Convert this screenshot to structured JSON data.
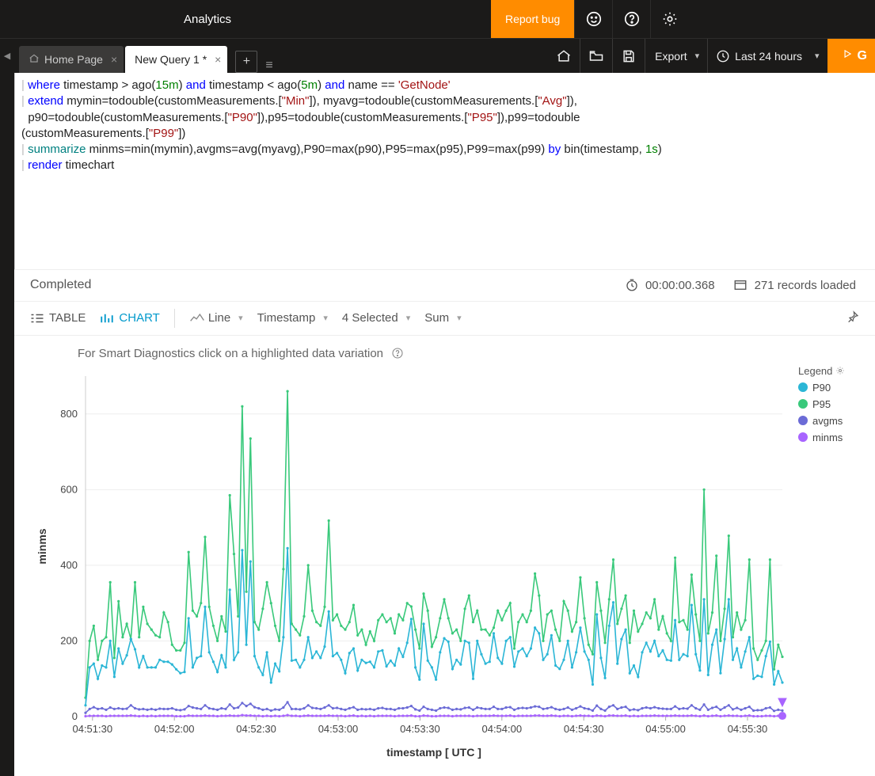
{
  "header": {
    "brand": "Analytics",
    "report_bug": "Report bug"
  },
  "tabs": {
    "home": "Home Page",
    "active": "New Query 1 *"
  },
  "toolbar": {
    "export": "Export",
    "time_range": "Last 24 hours",
    "go": "G"
  },
  "editor": {
    "l1a": "| ",
    "l1_where": "where",
    "l1b": " timestamp > ago(",
    "l1_15m": "15m",
    "l1c": ") ",
    "l1_and1": "and",
    "l1d": " timestamp < ago(",
    "l1_5m": "5m",
    "l1e": ") ",
    "l1_and2": "and",
    "l1f": " name == ",
    "l1_str": "'GetNode'",
    "l2a": "| ",
    "l2_extend": "extend",
    "l2b": " mymin=todouble(customMeasurements.[",
    "l2_min": "\"Min\"",
    "l2c": "]), myavg=todouble(customMeasurements.[",
    "l2_avg": "\"Avg\"",
    "l2d": "]),",
    "l3a": "  p90=todouble(customMeasurements.[",
    "l3_p90": "\"P90\"",
    "l3b": "]),p95=todouble(customMeasurements.[",
    "l3_p95": "\"P95\"",
    "l3c": "]),p99=todouble",
    "l4a": "(customMeasurements.[",
    "l4_p99": "\"P99\"",
    "l4b": "])",
    "l5a": "| ",
    "l5_sum": "summarize",
    "l5b": " minms=min(mymin),avgms=avg(myavg),P90=max(p90),P95=max(p95),P99=max(p99) ",
    "l5_by": "by",
    "l5c": " bin(timestamp, ",
    "l5_1s": "1s",
    "l5d": ")",
    "l6a": "| ",
    "l6_render": "render",
    "l6b": " timechart"
  },
  "status": {
    "completed": "Completed",
    "duration": "00:00:00.368",
    "records": "271 records loaded"
  },
  "chart_toolbar": {
    "table": "TABLE",
    "chart": "CHART",
    "chart_type": "Line",
    "x_axis": "Timestamp",
    "selected": "4 Selected",
    "agg": "Sum"
  },
  "smart_diag": "For Smart Diagnostics click on a highlighted data variation",
  "legend": {
    "title": "Legend",
    "items": [
      {
        "name": "P90",
        "color": "#2bb6d6"
      },
      {
        "name": "P95",
        "color": "#39c97b"
      },
      {
        "name": "avgms",
        "color": "#6b6bd6"
      },
      {
        "name": "minms",
        "color": "#a864ff"
      }
    ]
  },
  "chart_data": {
    "type": "line",
    "title": "",
    "xlabel": "timestamp [ UTC ]",
    "ylabel": "minms",
    "ylim": [
      0,
      900
    ],
    "y_ticks": [
      0,
      200,
      400,
      600,
      800
    ],
    "x_tick_labels": [
      "04:51:30",
      "04:52:00",
      "04:52:30",
      "04:53:00",
      "04:53:30",
      "04:54:00",
      "04:54:30",
      "04:55:00",
      "04:55:30"
    ],
    "series": [
      {
        "name": "P95",
        "color": "#39c97b",
        "values": [
          50,
          200,
          240,
          150,
          200,
          210,
          355,
          155,
          305,
          210,
          245,
          205,
          355,
          210,
          290,
          245,
          230,
          215,
          210,
          275,
          250,
          190,
          175,
          175,
          195,
          435,
          280,
          265,
          300,
          475,
          290,
          240,
          200,
          265,
          225,
          585,
          430,
          265,
          820,
          330,
          735,
          250,
          230,
          285,
          355,
          300,
          240,
          200,
          390,
          860,
          245,
          230,
          215,
          265,
          400,
          280,
          250,
          240,
          290,
          518,
          255,
          270,
          240,
          230,
          250,
          295,
          215,
          230,
          190,
          225,
          200,
          255,
          270,
          250,
          260,
          220,
          270,
          255,
          300,
          291,
          230,
          180,
          325,
          280,
          185,
          210,
          260,
          310,
          260,
          220,
          230,
          200,
          285,
          320,
          250,
          280,
          230,
          230,
          215,
          235,
          280,
          255,
          280,
          300,
          180,
          250,
          270,
          250,
          280,
          378,
          320,
          200,
          270,
          280,
          230,
          200,
          305,
          280,
          225,
          250,
          368,
          260,
          190,
          165,
          355,
          280,
          195,
          310,
          415,
          245,
          285,
          320,
          195,
          280,
          225,
          245,
          275,
          260,
          310,
          230,
          265,
          220,
          200,
          420,
          250,
          255,
          230,
          375,
          270,
          200,
          600,
          220,
          275,
          425,
          200,
          285,
          478,
          210,
          275,
          230,
          255,
          415,
          180,
          150,
          175,
          200,
          415,
          125,
          190,
          158
        ]
      },
      {
        "name": "P90",
        "color": "#2bb6d6",
        "values": [
          30,
          130,
          140,
          100,
          135,
          130,
          200,
          105,
          180,
          140,
          162,
          205,
          178,
          130,
          160,
          130,
          130,
          130,
          150,
          145,
          145,
          138,
          125,
          115,
          118,
          260,
          130,
          155,
          160,
          290,
          170,
          145,
          118,
          162,
          130,
          335,
          150,
          170,
          440,
          190,
          410,
          160,
          130,
          110,
          170,
          90,
          140,
          120,
          210,
          445,
          148,
          150,
          130,
          150,
          210,
          155,
          172,
          155,
          185,
          278,
          160,
          168,
          150,
          115,
          168,
          180,
          122,
          150,
          142,
          145,
          130,
          172,
          175,
          133,
          148,
          135,
          180,
          158,
          195,
          258,
          130,
          98,
          245,
          148,
          130,
          98,
          170,
          207,
          198,
          126,
          150,
          138,
          200,
          195,
          100,
          200,
          165,
          140,
          145,
          220,
          155,
          140,
          200,
          210,
          132,
          172,
          180,
          160,
          180,
          235,
          220,
          150,
          165,
          215,
          135,
          126,
          150,
          200,
          130,
          170,
          235,
          172,
          150,
          85,
          270,
          155,
          102,
          240,
          302,
          140,
          205,
          230,
          115,
          135,
          105,
          170,
          195,
          172,
          200,
          160,
          175,
          150,
          148,
          255,
          150,
          165,
          160,
          295,
          165,
          122,
          310,
          110,
          190,
          230,
          115,
          205,
          310,
          150,
          180,
          130,
          172,
          210,
          100,
          108,
          105,
          160,
          198,
          85,
          120,
          90
        ]
      },
      {
        "name": "avgms",
        "color": "#6b6bd6",
        "values": [
          10,
          20,
          25,
          20,
          22,
          18,
          24,
          20,
          22,
          20,
          21,
          30,
          22,
          19,
          20,
          18,
          20,
          18,
          21,
          20,
          20,
          22,
          18,
          17,
          19,
          28,
          24,
          22,
          20,
          30,
          22,
          20,
          18,
          22,
          20,
          32,
          22,
          24,
          36,
          28,
          34,
          25,
          22,
          18,
          20,
          16,
          19,
          18,
          24,
          38,
          20,
          20,
          19,
          22,
          30,
          23,
          22,
          20,
          24,
          30,
          22,
          23,
          20,
          18,
          22,
          25,
          18,
          20,
          19,
          20,
          18,
          22,
          23,
          20,
          20,
          18,
          22,
          22,
          24,
          28,
          19,
          16,
          26,
          20,
          18,
          16,
          22,
          24,
          23,
          18,
          20,
          19,
          23,
          24,
          18,
          24,
          22,
          20,
          20,
          26,
          20,
          20,
          24,
          25,
          18,
          22,
          23,
          22,
          24,
          27,
          26,
          20,
          22,
          25,
          20,
          18,
          20,
          24,
          18,
          22,
          27,
          22,
          20,
          16,
          29,
          20,
          16,
          26,
          30,
          20,
          24,
          26,
          17,
          19,
          17,
          22,
          24,
          22,
          25,
          22,
          21,
          20,
          20,
          27,
          20,
          22,
          21,
          30,
          22,
          18,
          32,
          18,
          23,
          26,
          18,
          24,
          30,
          19,
          23,
          18,
          22,
          26,
          16,
          17,
          17,
          22,
          24,
          15,
          18,
          16
        ]
      },
      {
        "name": "minms",
        "color": "#a864ff",
        "values": [
          1,
          2,
          2,
          2,
          2,
          1,
          2,
          2,
          2,
          2,
          2,
          3,
          2,
          1,
          2,
          1,
          2,
          1,
          2,
          2,
          2,
          2,
          1,
          1,
          1,
          3,
          2,
          2,
          2,
          3,
          2,
          2,
          1,
          2,
          2,
          3,
          2,
          2,
          4,
          3,
          3,
          2,
          2,
          1,
          2,
          1,
          2,
          1,
          2,
          4,
          2,
          2,
          1,
          2,
          3,
          2,
          2,
          2,
          2,
          3,
          2,
          2,
          2,
          1,
          2,
          3,
          1,
          2,
          1,
          2,
          1,
          2,
          2,
          2,
          2,
          1,
          2,
          2,
          2,
          3,
          1,
          1,
          3,
          2,
          1,
          1,
          2,
          2,
          2,
          1,
          2,
          2,
          2,
          2,
          1,
          2,
          2,
          2,
          2,
          3,
          2,
          2,
          2,
          3,
          1,
          2,
          2,
          2,
          2,
          3,
          3,
          2,
          2,
          3,
          2,
          1,
          2,
          2,
          1,
          2,
          3,
          2,
          2,
          1,
          3,
          2,
          1,
          3,
          3,
          2,
          2,
          3,
          1,
          2,
          1,
          2,
          2,
          2,
          3,
          2,
          2,
          2,
          2,
          3,
          2,
          2,
          2,
          3,
          2,
          1,
          3,
          1,
          2,
          3,
          1,
          2,
          3,
          2,
          2,
          1,
          2,
          3,
          1,
          1,
          1,
          2,
          2,
          1,
          2,
          1
        ]
      }
    ]
  }
}
